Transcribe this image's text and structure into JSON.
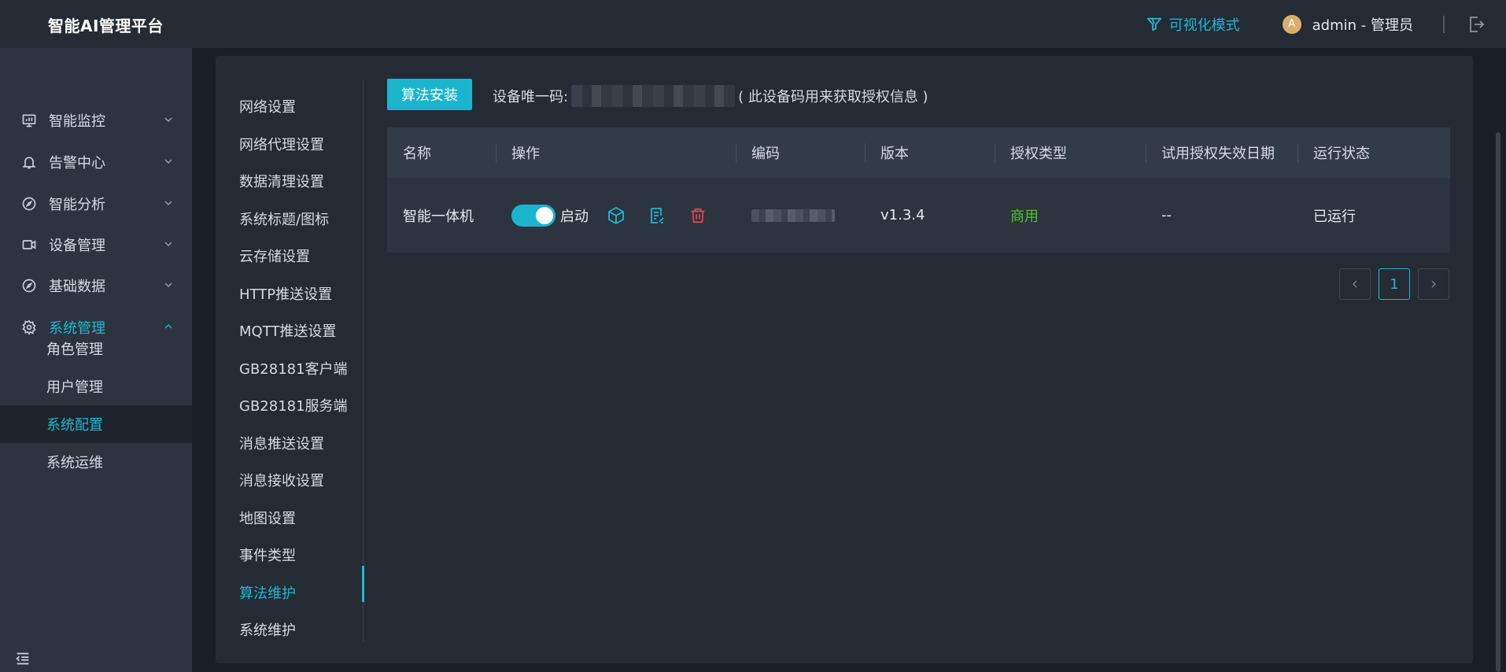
{
  "app": {
    "title": "智能AI管理平台"
  },
  "header": {
    "vis_mode": "可视化模式",
    "avatar_letter": "A",
    "user": "admin - 管理员"
  },
  "sidebar": {
    "items": [
      {
        "label": "智能监控",
        "icon": "monitor-icon"
      },
      {
        "label": "告警中心",
        "icon": "bell-icon"
      },
      {
        "label": "智能分析",
        "icon": "compass-icon"
      },
      {
        "label": "设备管理",
        "icon": "camera-icon"
      },
      {
        "label": "基础数据",
        "icon": "compass-icon"
      },
      {
        "label": "系统管理",
        "icon": "gear-icon",
        "expanded": true
      }
    ],
    "sub_items": [
      {
        "label": "角色管理"
      },
      {
        "label": "用户管理"
      },
      {
        "label": "系统配置",
        "active": true
      },
      {
        "label": "系统运维"
      }
    ]
  },
  "settings_menu": [
    "网络设置",
    "网络代理设置",
    "数据清理设置",
    "系统标题/图标",
    "云存储设置",
    "HTTP推送设置",
    "MQTT推送设置",
    "GB28181客户端",
    "GB28181服务端",
    "消息推送设置",
    "消息接收设置",
    "地图设置",
    "事件类型",
    "算法维护",
    "系统维护"
  ],
  "settings_active": "算法维护",
  "toolbar": {
    "install_label": "算法安装",
    "device_code_label": "设备唯一码:",
    "device_code_note": "( 此设备码用来获取授权信息 )"
  },
  "table": {
    "columns": [
      "名称",
      "操作",
      "编码",
      "版本",
      "授权类型",
      "试用授权失效日期",
      "运行状态"
    ],
    "rows": [
      {
        "name": "智能一体机",
        "toggle_label": "启动",
        "toggle_on": true,
        "version": "v1.3.4",
        "license_type": "商用",
        "trial_expiry": "--",
        "status": "已运行"
      }
    ]
  },
  "pagination": {
    "current": "1"
  },
  "colors": {
    "accent": "#1fb8d0",
    "success": "#52c41a",
    "danger": "#e5484d"
  }
}
